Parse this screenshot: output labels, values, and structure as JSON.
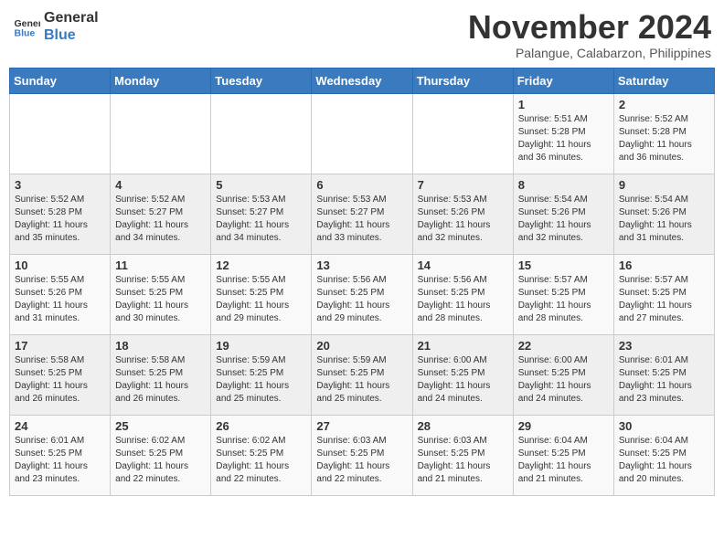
{
  "header": {
    "logo_line1": "General",
    "logo_line2": "Blue",
    "month_title": "November 2024",
    "location": "Palangue, Calabarzon, Philippines"
  },
  "weekdays": [
    "Sunday",
    "Monday",
    "Tuesday",
    "Wednesday",
    "Thursday",
    "Friday",
    "Saturday"
  ],
  "weeks": [
    [
      {
        "day": "",
        "info": ""
      },
      {
        "day": "",
        "info": ""
      },
      {
        "day": "",
        "info": ""
      },
      {
        "day": "",
        "info": ""
      },
      {
        "day": "",
        "info": ""
      },
      {
        "day": "1",
        "info": "Sunrise: 5:51 AM\nSunset: 5:28 PM\nDaylight: 11 hours\nand 36 minutes."
      },
      {
        "day": "2",
        "info": "Sunrise: 5:52 AM\nSunset: 5:28 PM\nDaylight: 11 hours\nand 36 minutes."
      }
    ],
    [
      {
        "day": "3",
        "info": "Sunrise: 5:52 AM\nSunset: 5:28 PM\nDaylight: 11 hours\nand 35 minutes."
      },
      {
        "day": "4",
        "info": "Sunrise: 5:52 AM\nSunset: 5:27 PM\nDaylight: 11 hours\nand 34 minutes."
      },
      {
        "day": "5",
        "info": "Sunrise: 5:53 AM\nSunset: 5:27 PM\nDaylight: 11 hours\nand 34 minutes."
      },
      {
        "day": "6",
        "info": "Sunrise: 5:53 AM\nSunset: 5:27 PM\nDaylight: 11 hours\nand 33 minutes."
      },
      {
        "day": "7",
        "info": "Sunrise: 5:53 AM\nSunset: 5:26 PM\nDaylight: 11 hours\nand 32 minutes."
      },
      {
        "day": "8",
        "info": "Sunrise: 5:54 AM\nSunset: 5:26 PM\nDaylight: 11 hours\nand 32 minutes."
      },
      {
        "day": "9",
        "info": "Sunrise: 5:54 AM\nSunset: 5:26 PM\nDaylight: 11 hours\nand 31 minutes."
      }
    ],
    [
      {
        "day": "10",
        "info": "Sunrise: 5:55 AM\nSunset: 5:26 PM\nDaylight: 11 hours\nand 31 minutes."
      },
      {
        "day": "11",
        "info": "Sunrise: 5:55 AM\nSunset: 5:25 PM\nDaylight: 11 hours\nand 30 minutes."
      },
      {
        "day": "12",
        "info": "Sunrise: 5:55 AM\nSunset: 5:25 PM\nDaylight: 11 hours\nand 29 minutes."
      },
      {
        "day": "13",
        "info": "Sunrise: 5:56 AM\nSunset: 5:25 PM\nDaylight: 11 hours\nand 29 minutes."
      },
      {
        "day": "14",
        "info": "Sunrise: 5:56 AM\nSunset: 5:25 PM\nDaylight: 11 hours\nand 28 minutes."
      },
      {
        "day": "15",
        "info": "Sunrise: 5:57 AM\nSunset: 5:25 PM\nDaylight: 11 hours\nand 28 minutes."
      },
      {
        "day": "16",
        "info": "Sunrise: 5:57 AM\nSunset: 5:25 PM\nDaylight: 11 hours\nand 27 minutes."
      }
    ],
    [
      {
        "day": "17",
        "info": "Sunrise: 5:58 AM\nSunset: 5:25 PM\nDaylight: 11 hours\nand 26 minutes."
      },
      {
        "day": "18",
        "info": "Sunrise: 5:58 AM\nSunset: 5:25 PM\nDaylight: 11 hours\nand 26 minutes."
      },
      {
        "day": "19",
        "info": "Sunrise: 5:59 AM\nSunset: 5:25 PM\nDaylight: 11 hours\nand 25 minutes."
      },
      {
        "day": "20",
        "info": "Sunrise: 5:59 AM\nSunset: 5:25 PM\nDaylight: 11 hours\nand 25 minutes."
      },
      {
        "day": "21",
        "info": "Sunrise: 6:00 AM\nSunset: 5:25 PM\nDaylight: 11 hours\nand 24 minutes."
      },
      {
        "day": "22",
        "info": "Sunrise: 6:00 AM\nSunset: 5:25 PM\nDaylight: 11 hours\nand 24 minutes."
      },
      {
        "day": "23",
        "info": "Sunrise: 6:01 AM\nSunset: 5:25 PM\nDaylight: 11 hours\nand 23 minutes."
      }
    ],
    [
      {
        "day": "24",
        "info": "Sunrise: 6:01 AM\nSunset: 5:25 PM\nDaylight: 11 hours\nand 23 minutes."
      },
      {
        "day": "25",
        "info": "Sunrise: 6:02 AM\nSunset: 5:25 PM\nDaylight: 11 hours\nand 22 minutes."
      },
      {
        "day": "26",
        "info": "Sunrise: 6:02 AM\nSunset: 5:25 PM\nDaylight: 11 hours\nand 22 minutes."
      },
      {
        "day": "27",
        "info": "Sunrise: 6:03 AM\nSunset: 5:25 PM\nDaylight: 11 hours\nand 22 minutes."
      },
      {
        "day": "28",
        "info": "Sunrise: 6:03 AM\nSunset: 5:25 PM\nDaylight: 11 hours\nand 21 minutes."
      },
      {
        "day": "29",
        "info": "Sunrise: 6:04 AM\nSunset: 5:25 PM\nDaylight: 11 hours\nand 21 minutes."
      },
      {
        "day": "30",
        "info": "Sunrise: 6:04 AM\nSunset: 5:25 PM\nDaylight: 11 hours\nand 20 minutes."
      }
    ]
  ]
}
